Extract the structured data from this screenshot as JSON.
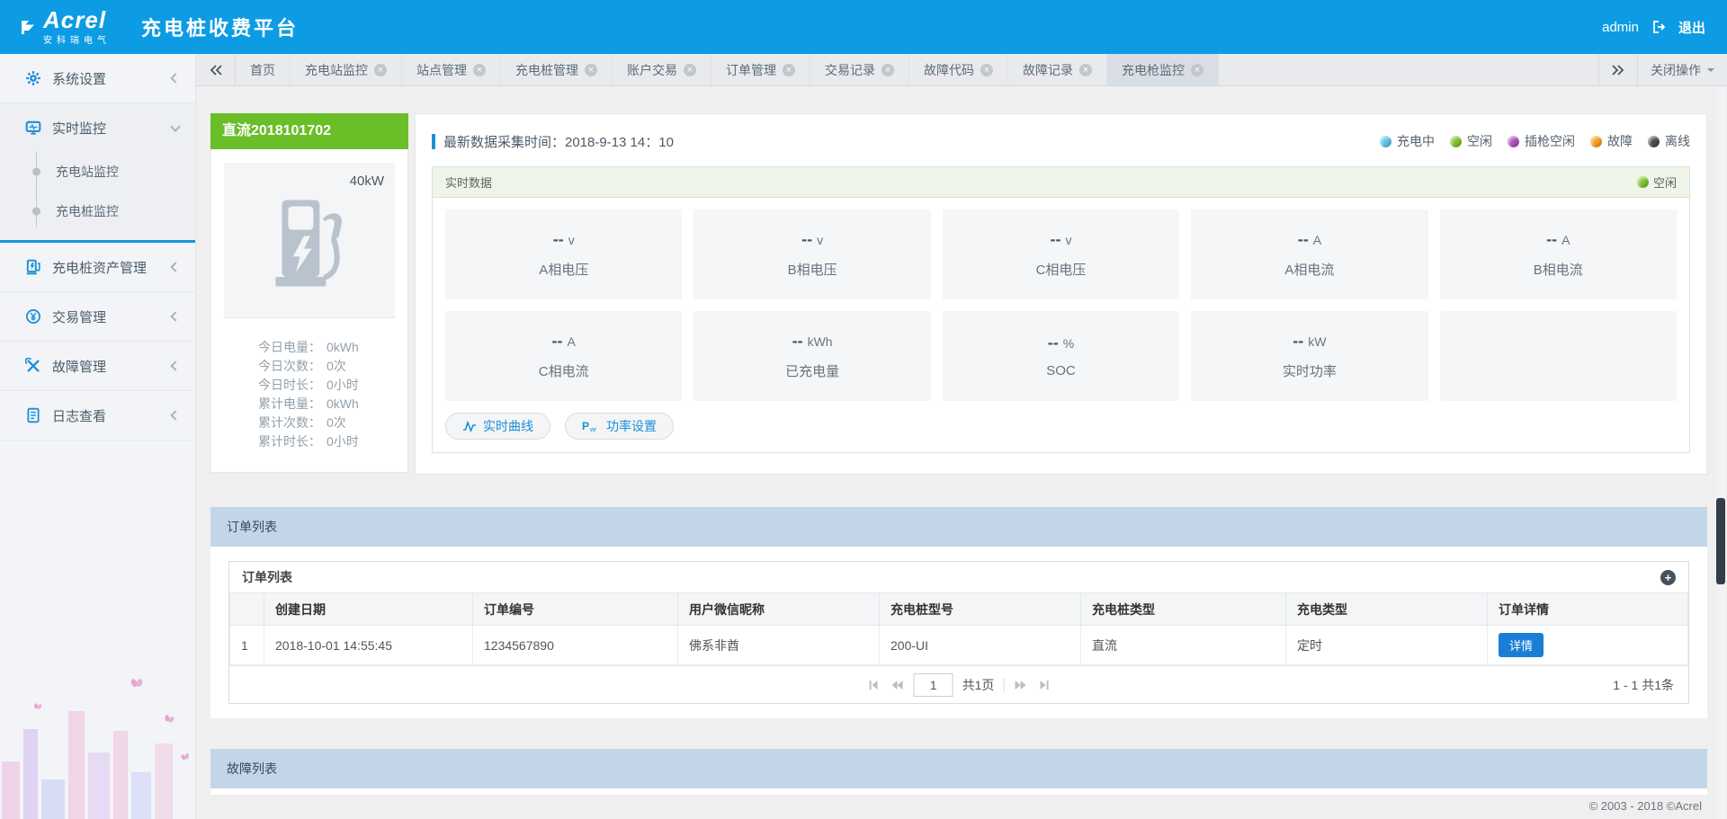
{
  "header": {
    "logo_main": "Acrel",
    "logo_sub": "安科瑞电气",
    "title": "充电桩收费平台",
    "username": "admin",
    "logout_label": "退出"
  },
  "tabbar": {
    "close_ops_label": "关闭操作",
    "tabs": [
      {
        "label": "首页",
        "closable": false,
        "active": false
      },
      {
        "label": "充电站监控",
        "closable": true,
        "active": false
      },
      {
        "label": "站点管理",
        "closable": true,
        "active": false
      },
      {
        "label": "充电桩管理",
        "closable": true,
        "active": false
      },
      {
        "label": "账户交易",
        "closable": true,
        "active": false
      },
      {
        "label": "订单管理",
        "closable": true,
        "active": false
      },
      {
        "label": "交易记录",
        "closable": true,
        "active": false
      },
      {
        "label": "故障代码",
        "closable": true,
        "active": false
      },
      {
        "label": "故障记录",
        "closable": true,
        "active": false
      },
      {
        "label": "充电枪监控",
        "closable": true,
        "active": true
      }
    ]
  },
  "sidebar": {
    "items": [
      {
        "label": "系统设置",
        "icon": "gear"
      },
      {
        "label": "实时监控",
        "icon": "monitor",
        "expanded": true,
        "children": [
          "充电站监控",
          "充电桩监控"
        ]
      },
      {
        "label": "充电桩资产管理",
        "icon": "charger"
      },
      {
        "label": "交易管理",
        "icon": "yuan"
      },
      {
        "label": "故障管理",
        "icon": "tools"
      },
      {
        "label": "日志查看",
        "icon": "log"
      }
    ]
  },
  "device": {
    "name": "直流2018101702",
    "power_rating": "40kW",
    "stats": [
      {
        "label": "今日电量：",
        "value": "0kWh"
      },
      {
        "label": "今日次数：",
        "value": "0次"
      },
      {
        "label": "今日时长：",
        "value": "0小时"
      },
      {
        "label": "累计电量：",
        "value": "0kWh"
      },
      {
        "label": "累计次数：",
        "value": "0次"
      },
      {
        "label": "累计时长：",
        "value": "0小时"
      }
    ]
  },
  "monitor": {
    "collect_time": "最新数据采集时间：2018-9-13 14：10",
    "legend": [
      {
        "label": "充电中",
        "color": "#62c3e4"
      },
      {
        "label": "空闲",
        "color": "#7fc32c"
      },
      {
        "label": "插枪空闲",
        "color": "#b04fc0"
      },
      {
        "label": "故障",
        "color": "#f7a11a"
      },
      {
        "label": "离线",
        "color": "#4b4b4b"
      }
    ],
    "section_title": "实时数据",
    "status_label": "空闲",
    "status_color": "#7fc32c",
    "metrics": [
      {
        "value": "--",
        "unit": "v",
        "label": "A相电压"
      },
      {
        "value": "--",
        "unit": "v",
        "label": "B相电压"
      },
      {
        "value": "--",
        "unit": "v",
        "label": "C相电压"
      },
      {
        "value": "--",
        "unit": "A",
        "label": "A相电流"
      },
      {
        "value": "--",
        "unit": "A",
        "label": "B相电流"
      },
      {
        "value": "--",
        "unit": "A",
        "label": "C相电流"
      },
      {
        "value": "--",
        "unit": "kWh",
        "label": "已充电量"
      },
      {
        "value": "--",
        "unit": "%",
        "label": "SOC"
      },
      {
        "value": "--",
        "unit": "kW",
        "label": "实时功率"
      }
    ],
    "curve_button": "实时曲线",
    "power_button": "功率设置"
  },
  "orders": {
    "section_title": "订单列表",
    "panel_title": "订单列表",
    "columns": [
      "创建日期",
      "订单编号",
      "用户微信昵称",
      "充电桩型号",
      "充电桩类型",
      "充电类型",
      "订单详情"
    ],
    "row": {
      "index": "1",
      "created": "2018-10-01 14:55:45",
      "order_no": "1234567890",
      "wechat_nick": "佛系非酋",
      "pile_model": "200-UI",
      "pile_type": "直流",
      "charge_type": "定时",
      "detail_label": "详情"
    },
    "pagination": {
      "page": "1",
      "total_pages": "共1页",
      "summary": "1 - 1  共1条"
    }
  },
  "faults": {
    "section_title": "故障列表"
  },
  "footer": {
    "copyright": "© 2003 - 2018 ©Acrel"
  }
}
